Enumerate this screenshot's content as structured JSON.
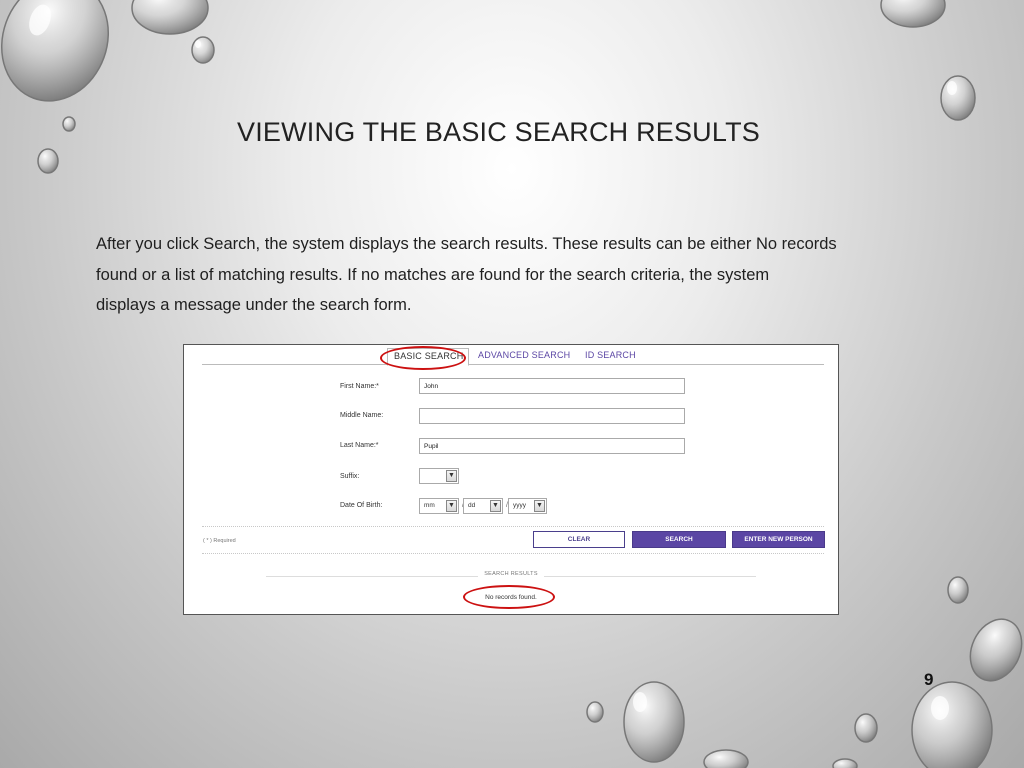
{
  "slide": {
    "title": "VIEWING THE BASIC SEARCH RESULTS",
    "body_lines": [
      "After you click Search, the system displays the search results.  These results can be either No records",
      "found or a list of matching results.  If no matches are found for the search criteria, the system",
      "displays a message under the search form."
    ],
    "page_number": "9"
  },
  "screenshot": {
    "tabs": {
      "basic": "BASIC SEARCH",
      "advanced": "ADVANCED SEARCH",
      "id": "ID SEARCH"
    },
    "form": {
      "first_name": {
        "label": "First Name:*",
        "value": "John"
      },
      "middle_name": {
        "label": "Middle Name:",
        "value": ""
      },
      "last_name": {
        "label": "Last Name:*",
        "value": "Pupil"
      },
      "suffix": {
        "label": "Suffix:",
        "value": ""
      },
      "dob": {
        "label": "Date Of Birth:",
        "month": "mm",
        "day": "dd",
        "year": "yyyy",
        "separator": "/"
      }
    },
    "required_note": "( * ) Required",
    "buttons": {
      "clear": "CLEAR",
      "search": "SEARCH",
      "new_person": "ENTER NEW PERSON"
    },
    "results": {
      "heading": "SEARCH RESULTS",
      "message": "No records found."
    },
    "colors": {
      "accent": "#5b46a4",
      "highlight_oval": "#cc1111"
    }
  }
}
